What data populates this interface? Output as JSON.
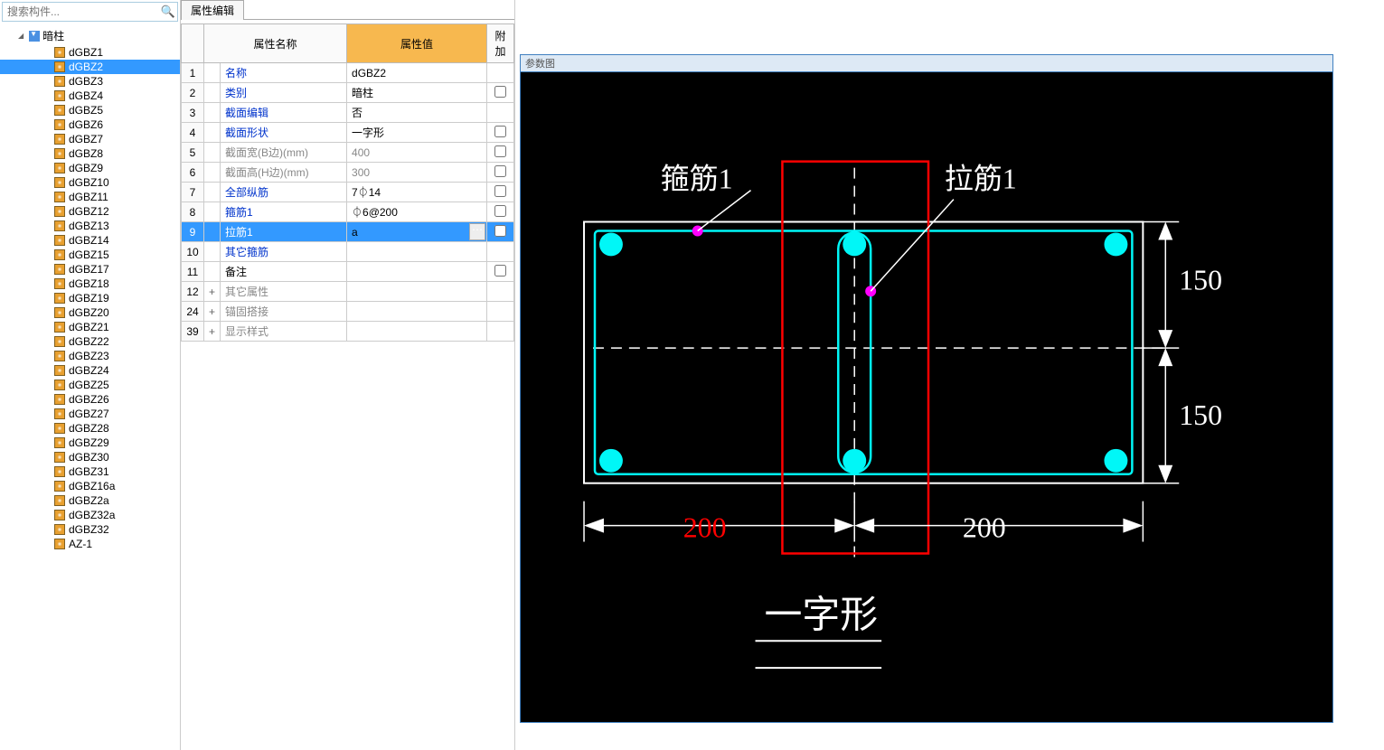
{
  "search": {
    "placeholder": "搜索构件..."
  },
  "tree": {
    "root_label": "暗柱",
    "items": [
      "dGBZ1",
      "dGBZ2",
      "dGBZ3",
      "dGBZ4",
      "dGBZ5",
      "dGBZ6",
      "dGBZ7",
      "dGBZ8",
      "dGBZ9",
      "dGBZ10",
      "dGBZ11",
      "dGBZ12",
      "dGBZ13",
      "dGBZ14",
      "dGBZ15",
      "dGBZ17",
      "dGBZ18",
      "dGBZ19",
      "dGBZ20",
      "dGBZ21",
      "dGBZ22",
      "dGBZ23",
      "dGBZ24",
      "dGBZ25",
      "dGBZ26",
      "dGBZ27",
      "dGBZ28",
      "dGBZ29",
      "dGBZ30",
      "dGBZ31",
      "dGBZ16a",
      "dGBZ2a",
      "dGBZ32a",
      "dGBZ32",
      "AZ-1"
    ],
    "selected_index": 1
  },
  "prop_panel": {
    "tab": "属性编辑",
    "headers": {
      "name": "属性名称",
      "value": "属性值",
      "extra": "附加"
    },
    "rows": [
      {
        "n": "1",
        "name": "名称",
        "val": "dGBZ2",
        "link": true,
        "check": null
      },
      {
        "n": "2",
        "name": "类别",
        "val": "暗柱",
        "link": true,
        "check": false
      },
      {
        "n": "3",
        "name": "截面编辑",
        "val": "否",
        "link": true,
        "check": null
      },
      {
        "n": "4",
        "name": "截面形状",
        "val": "一字形",
        "link": true,
        "check": false
      },
      {
        "n": "5",
        "name": "截面宽(B边)(mm)",
        "val": "400",
        "gray": true,
        "check": false
      },
      {
        "n": "6",
        "name": "截面高(H边)(mm)",
        "val": "300",
        "gray": true,
        "check": false
      },
      {
        "n": "7",
        "name": "全部纵筋",
        "val": "7⏀14",
        "link": true,
        "check": false
      },
      {
        "n": "8",
        "name": "箍筋1",
        "val": "⏀6@200",
        "link": true,
        "check": false
      },
      {
        "n": "9",
        "name": "拉筋1",
        "val": "a",
        "link": true,
        "selected": true,
        "editable": true,
        "check": false
      },
      {
        "n": "10",
        "name": "其它箍筋",
        "val": "",
        "link": true,
        "check": null
      },
      {
        "n": "11",
        "name": "备注",
        "val": "",
        "check": false
      },
      {
        "n": "12",
        "name": "其它属性",
        "val": "",
        "gray": true,
        "expand": "+"
      },
      {
        "n": "24",
        "name": "锚固搭接",
        "val": "",
        "gray": true,
        "expand": "+"
      },
      {
        "n": "39",
        "name": "显示样式",
        "val": "",
        "gray": true,
        "expand": "+"
      }
    ]
  },
  "diagram": {
    "title": "参数图",
    "labels": {
      "gujin": "箍筋1",
      "lajin": "拉筋1"
    },
    "dims": {
      "width_half": "200",
      "height_half": "150"
    },
    "shape_name": "一字形"
  }
}
